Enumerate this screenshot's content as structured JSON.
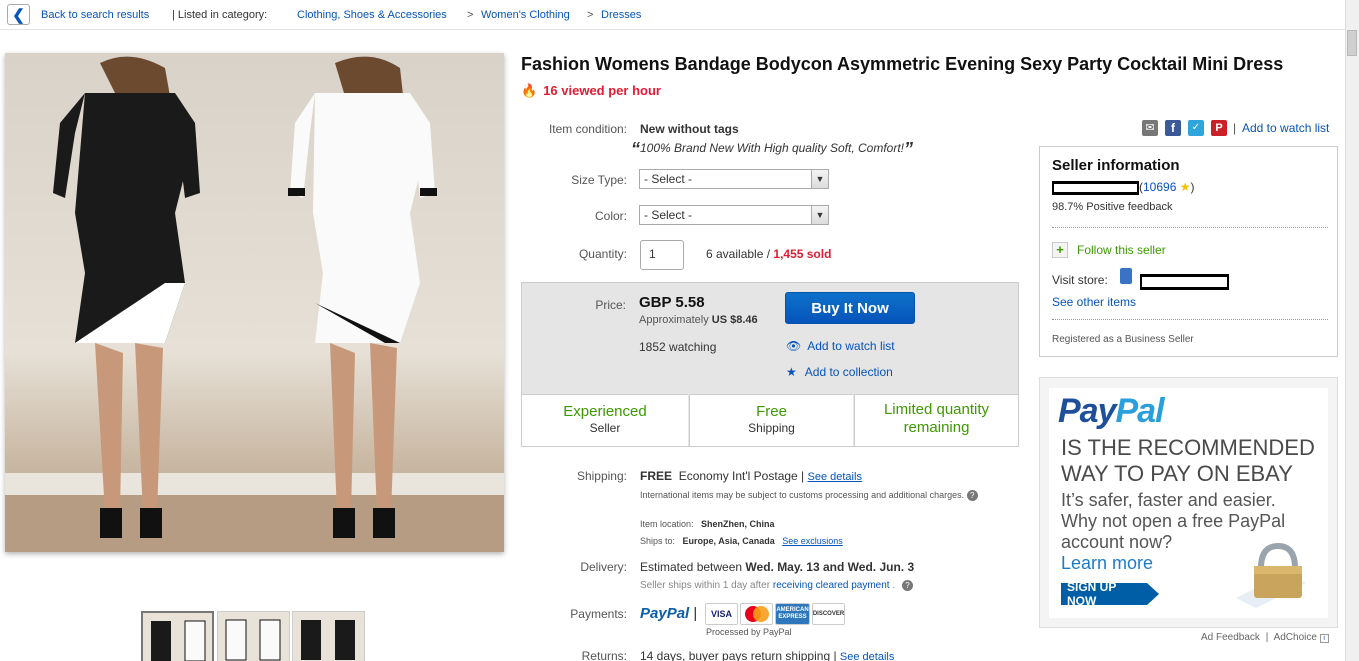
{
  "breadcrumb": {
    "back": "Back to search results",
    "listed": "| Listed in category:",
    "cat1": "Clothing, Shoes & Accessories",
    "sep": ">",
    "cat2": "Women's Clothing",
    "cat3": "Dresses"
  },
  "listing": {
    "title": "Fashion Womens Bandage Bodycon Asymmetric Evening Sexy Party Cocktail Mini Dress",
    "viewed": "16 viewed per hour",
    "condition_label": "Item condition:",
    "condition_value": "New without tags",
    "condition_quote": "100% Brand New With High quality Soft, Comfort!",
    "size_label": "Size Type:",
    "size_value": "- Select -",
    "color_label": "Color:",
    "color_value": "- Select -",
    "qty_label": "Quantity:",
    "qty_value": "1",
    "available": "6 available /",
    "sold": "1,455 sold"
  },
  "buy": {
    "price_label": "Price:",
    "price": "GBP 5.58",
    "approx_label": "Approximately",
    "approx_value": "US $8.46",
    "buy_now": "Buy It Now",
    "watching": "1852 watching",
    "add_watch": "Add to watch list",
    "add_collection": "Add to collection",
    "features": [
      {
        "big": "Experienced",
        "small": "Seller"
      },
      {
        "big": "Free",
        "small": "Shipping"
      },
      {
        "big": "Limited quantity remaining",
        "small": ""
      }
    ]
  },
  "shipping": {
    "label": "Shipping:",
    "free": "FREE",
    "method": "Economy Int'l Postage |",
    "details": "See details",
    "note": "International items may be subject to customs processing and additional charges.",
    "loc_label": "Item location:",
    "loc_value": "ShenZhen, China",
    "ships_label": "Ships to:",
    "ships_value": "Europe, Asia, Canada",
    "exclusions": "See exclusions",
    "delivery_label": "Delivery:",
    "delivery_prefix": "Estimated between",
    "delivery_dates": "Wed. May. 13 and Wed. Jun. 3",
    "delivery_note": "Seller ships within 1 day after",
    "cleared": "receiving cleared payment",
    "payments_label": "Payments:",
    "paypal": "PayPal",
    "processed": "Processed by PayPal",
    "cards": [
      "VISA",
      "MasterCard",
      "AMERICAN EXPRESS",
      "DISCOVER"
    ],
    "returns_label": "Returns:",
    "returns_value": "14 days, buyer pays return shipping |",
    "returns_details": "See details"
  },
  "actions": {
    "add_watch": "Add to watch list"
  },
  "seller": {
    "heading": "Seller information",
    "score": "10696",
    "feedback": "98.7% Positive feedback",
    "follow": "Follow this seller",
    "visit": "Visit store:",
    "other": "See other items",
    "registered": "Registered as a Business Seller"
  },
  "ad": {
    "logo": "PayPal",
    "headline1": "IS THE RECOMMENDED",
    "headline2": "WAY TO PAY ON EBAY",
    "body1": "It’s safer, faster and easier.",
    "body2": "Why not open a free PayPal",
    "body3": "account now?",
    "learn": "Learn more",
    "signup": "SIGN UP NOW",
    "feedback": "Ad Feedback",
    "choice": "AdChoice"
  },
  "colors": {
    "link": "#0654ba",
    "red": "#dd1e31",
    "green": "#3c9a00",
    "buy_button": "#0654ba"
  }
}
